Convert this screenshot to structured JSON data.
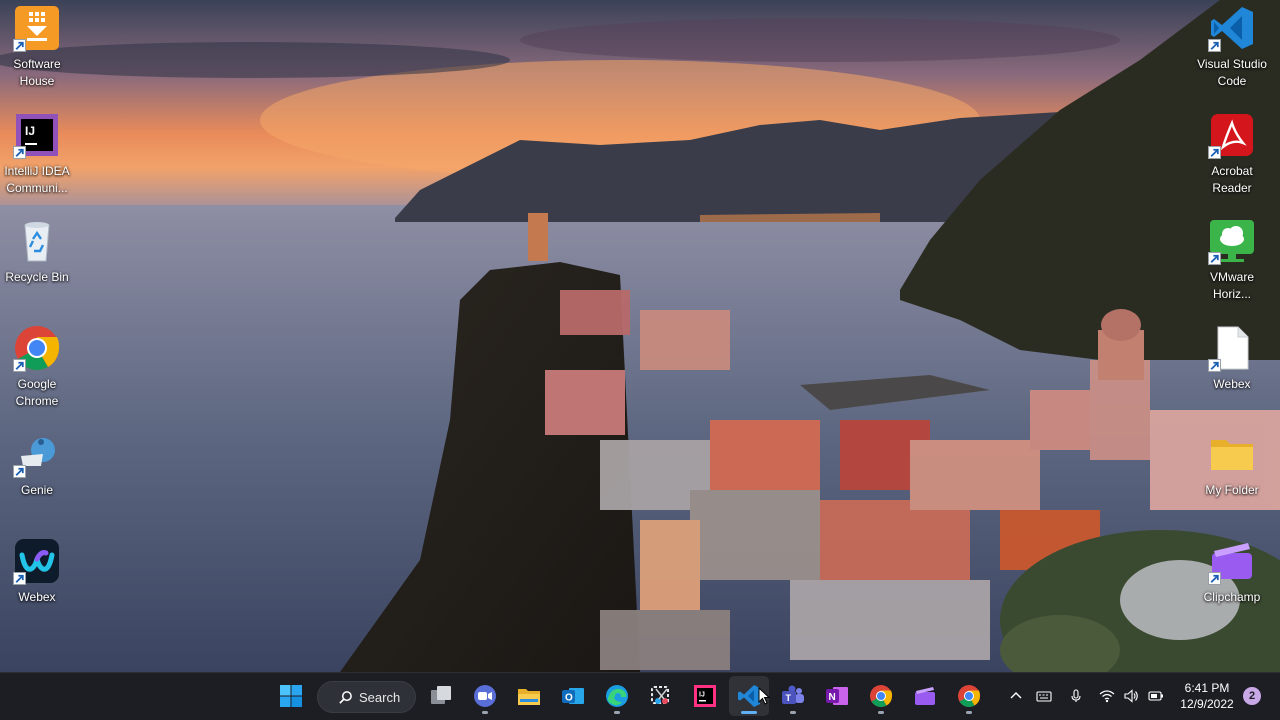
{
  "desktop": {
    "left_icons": [
      {
        "label": "Software House",
        "icon": "software-house-icon"
      },
      {
        "label": "IntelliJ IDEA Communi...",
        "icon": "intellij-idea-icon"
      },
      {
        "label": "Recycle Bin",
        "icon": "recycle-bin-icon"
      },
      {
        "label": "Google Chrome",
        "icon": "google-chrome-icon"
      },
      {
        "label": "Genie",
        "icon": "genie-icon"
      },
      {
        "label": "Webex",
        "icon": "webex-icon"
      }
    ],
    "right_icons": [
      {
        "label": "Visual Studio Code",
        "icon": "vscode-icon"
      },
      {
        "label": "Acrobat Reader",
        "icon": "acrobat-reader-icon"
      },
      {
        "label": "VMware Horiz...",
        "icon": "vmware-horizon-icon"
      },
      {
        "label": "Webex",
        "icon": "file-icon"
      },
      {
        "label": "My Folder",
        "icon": "folder-icon"
      },
      {
        "label": "Clipchamp",
        "icon": "clipchamp-icon"
      }
    ]
  },
  "taskbar": {
    "search_label": "Search",
    "apps": [
      {
        "name": "start",
        "icon": "windows-start-icon"
      },
      {
        "name": "task-view",
        "icon": "task-view-icon"
      },
      {
        "name": "zoom",
        "icon": "zoom-icon"
      },
      {
        "name": "file-explorer",
        "icon": "file-explorer-icon"
      },
      {
        "name": "outlook",
        "icon": "outlook-icon"
      },
      {
        "name": "edge",
        "icon": "edge-icon"
      },
      {
        "name": "snipping-tool",
        "icon": "snipping-tool-icon"
      },
      {
        "name": "intellij",
        "icon": "intellij-idea-icon"
      },
      {
        "name": "vscode",
        "icon": "vscode-icon",
        "active": true
      },
      {
        "name": "teams",
        "icon": "teams-icon"
      },
      {
        "name": "onenote",
        "icon": "onenote-icon"
      },
      {
        "name": "chrome",
        "icon": "google-chrome-icon"
      },
      {
        "name": "clipchamp",
        "icon": "clipchamp-icon"
      },
      {
        "name": "chrome-2",
        "icon": "google-chrome-icon"
      }
    ],
    "tray": {
      "time": "6:41 PM",
      "date": "12/9/2022",
      "notification_count": "2"
    }
  },
  "colors": {
    "taskbar_bg": "#1c1e24",
    "accent": "#60b0f4"
  }
}
